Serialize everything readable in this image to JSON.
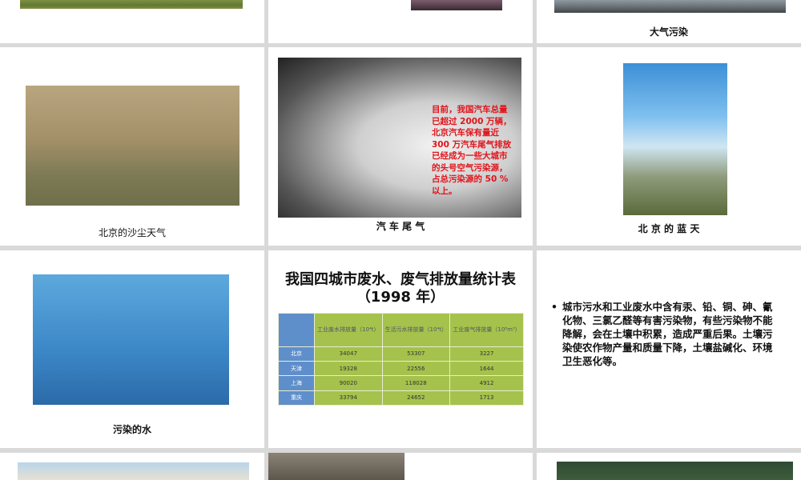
{
  "slides": {
    "top_right": {
      "caption": "大气污染"
    },
    "sandstorm": {
      "caption": "北京的沙尘天气"
    },
    "exhaust": {
      "caption": "汽 车 尾 气",
      "overlay_text": "目前，我国汽车总量已超过 2000 万辆，北京汽车保有量近 300 万汽车尾气排放已经成为一些大城市的头号空气污染源，占总污染源的 50 %以上。"
    },
    "blue_sky": {
      "caption": "北 京 的 蓝 天"
    },
    "water": {
      "caption": "污染的水"
    },
    "stats": {
      "title": "我国四城市废水、废气排放量统计表（1998 年）",
      "headers": [
        "工业废水排放量（10⁴t）",
        "生活污水排放量（10⁴t）",
        "工业废气排放量（10⁸m³）"
      ],
      "rows": [
        {
          "city": "北京",
          "values": [
            "34047",
            "53307",
            "3227"
          ]
        },
        {
          "city": "天津",
          "values": [
            "19328",
            "22556",
            "1644"
          ]
        },
        {
          "city": "上海",
          "values": [
            "90020",
            "118028",
            "4912"
          ]
        },
        {
          "city": "重庆",
          "values": [
            "33794",
            "24652",
            "1713"
          ]
        }
      ]
    },
    "soil": {
      "bullet": "•",
      "text": "城市污水和工业废水中含有汞、铅、铜、砷、氰化物、三氯乙醛等有害污染物，有些污染物不能降解，会在土壤中积累，造成严重后果。土壤污染使农作物产量和质量下降，土壤盐碱化、环境卫生恶化等。"
    }
  }
}
